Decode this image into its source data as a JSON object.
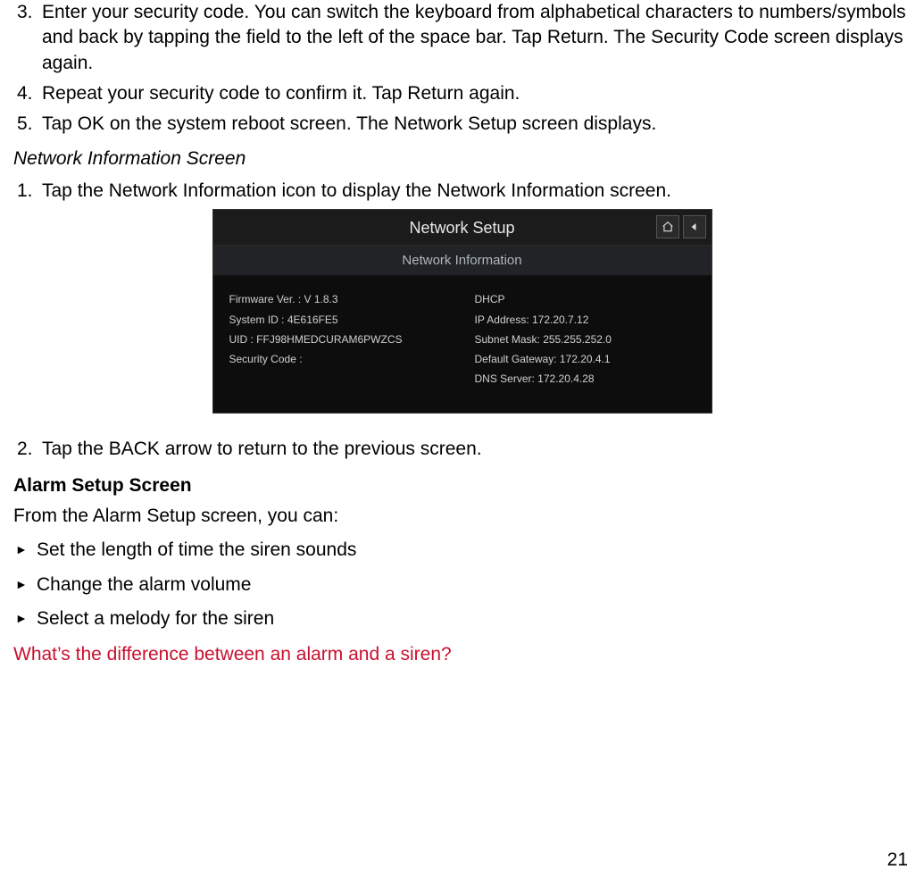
{
  "steps_top": [
    {
      "n": "3.",
      "text": "Enter your security code. You can switch the keyboard from alphabetical characters to numbers/symbols and back by tapping the field to the left of the space bar. Tap Return. The Security Code screen displays again."
    },
    {
      "n": "4.",
      "text": "Repeat your security code to confirm it. Tap Return again."
    },
    {
      "n": "5.",
      "text": "Tap OK on the system reboot screen. The Network Setup screen displays."
    }
  ],
  "network_info_heading": "Network Information Screen",
  "network_info_steps": [
    {
      "n": "1.",
      "text": "Tap the Network Information icon to display the Network Information screen."
    }
  ],
  "device": {
    "title": "Network Setup",
    "subtitle": "Network Information",
    "left": [
      "Firmware Ver. : V 1.8.3",
      "System ID : 4E616FE5",
      "UID : FFJ98HMEDCURAM6PWZCS",
      "Security Code :"
    ],
    "right": [
      "DHCP",
      "IP  Address: 172.20.7.12",
      "Subnet Mask: 255.255.252.0",
      "Default Gateway: 172.20.4.1",
      "DNS Server: 172.20.4.28"
    ]
  },
  "network_info_step2": {
    "n": "2.",
    "text": "Tap the BACK arrow to return to the previous screen."
  },
  "alarm_heading": "Alarm Setup Screen",
  "alarm_intro": "From the Alarm Setup screen, you can:",
  "alarm_bullets": [
    "Set the length of time the siren sounds",
    "Change the alarm volume",
    "Select a melody for the siren"
  ],
  "red_question": "What’s the difference between an alarm and a siren?",
  "page_number": "21"
}
